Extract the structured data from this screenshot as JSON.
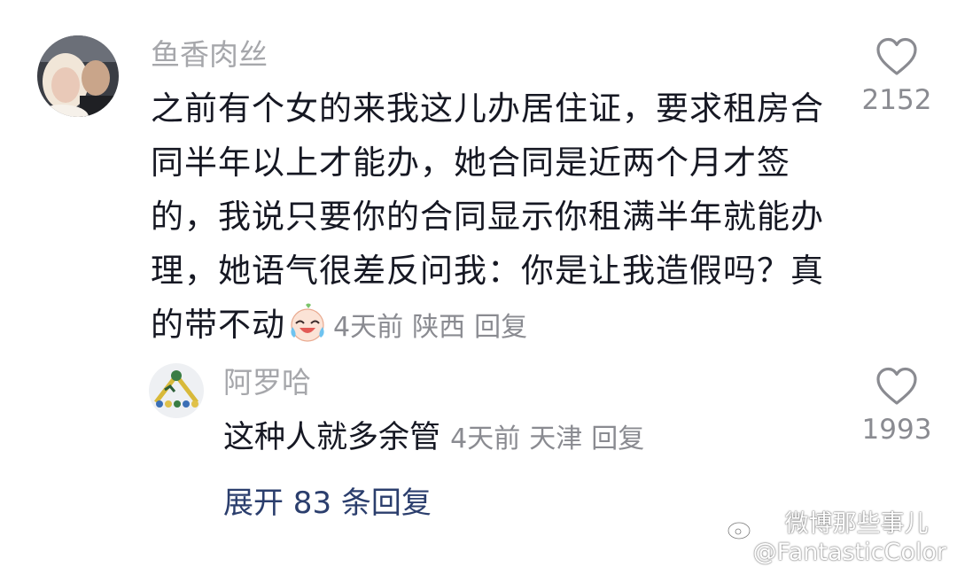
{
  "comment": {
    "username": "鱼香肉丝",
    "text": "之前有个女的来我这儿办居住证，要求租房合同半年以上才能办，她合同是近两个月才签的，我说只要你的合同显示你租满半年就能办理，她语气很差反问我：你是让我造假吗？真的带不动",
    "emoji": "crying-laughing-emoji",
    "time": "4天前",
    "location": "陕西",
    "reply_label": "回复",
    "likes": "2152"
  },
  "reply": {
    "username": "阿罗哈",
    "text": "这种人就多余管",
    "time": "4天前",
    "location": "天津",
    "reply_label": "回复",
    "likes": "1993"
  },
  "expand_label": "展开 83 条回复",
  "watermark": {
    "line1": "微博那些事儿",
    "line2": "@FantasticColor"
  },
  "colors": {
    "text": "#161823",
    "secondary": "#8a8b91",
    "username": "#a6a7ab",
    "link": "#2b3e6d"
  }
}
